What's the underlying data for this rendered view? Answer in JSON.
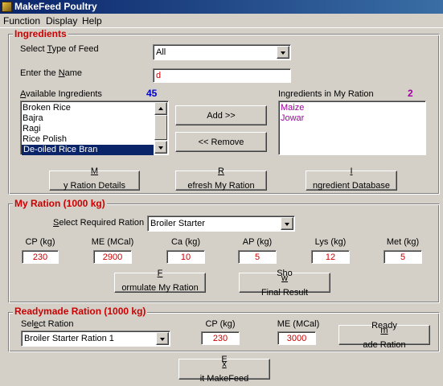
{
  "window": {
    "title": "MakeFeed Poultry"
  },
  "menu": {
    "function": "Function",
    "display": "Display",
    "help": "Help"
  },
  "ingredients": {
    "title": "Ingredients",
    "type_label": "Select Type of Feed",
    "type_value": "All",
    "name_label": "Enter the Name",
    "name_value": "d",
    "available_label": "Available Ingredients",
    "available_count": "45",
    "available_items": [
      "Broken Rice",
      "Bajra",
      "Ragi",
      "Rice Polish",
      "De-oiled Rice Bran"
    ],
    "selected_available": "De-oiled Rice Bran",
    "my_ration_label": "Ingredients in My Ration",
    "my_ration_count": "2",
    "my_ration_items": [
      "Maize",
      "Jowar"
    ],
    "add_button": "Add >>",
    "remove_button": "<< Remove",
    "details_button": "My Ration Details",
    "refresh_button": "Refresh My Ration",
    "database_button": "Ingredient Database"
  },
  "my_ration": {
    "title": "My Ration (1000 kg)",
    "required_label": "Select Required Ration",
    "required_value": "Broiler Starter",
    "nutrients": [
      {
        "label": "CP (kg)",
        "value": "230"
      },
      {
        "label": "ME (MCal)",
        "value": "2900"
      },
      {
        "label": "Ca (kg)",
        "value": "10"
      },
      {
        "label": "AP (kg)",
        "value": "5"
      },
      {
        "label": "Lys (kg)",
        "value": "12"
      },
      {
        "label": "Met (kg)",
        "value": "5"
      }
    ],
    "formulate_button": "Formulate My Ration",
    "show_result_button": "Show Final Result"
  },
  "readymade": {
    "title": "Readymade Ration (1000 kg)",
    "select_label": "Select Ration",
    "select_value": "Broiler Starter Ration 1",
    "cp_label": "CP (kg)",
    "cp_value": "230",
    "me_label": "ME (MCal)",
    "me_value": "3000",
    "button": "Readymade Ration"
  },
  "exit_button": "Exit MakeFeed",
  "colors": {
    "accent_red": "#cc0000",
    "count_blue": "#0000cc",
    "count_purple": "#a000a0",
    "selection": "#0a246a"
  }
}
